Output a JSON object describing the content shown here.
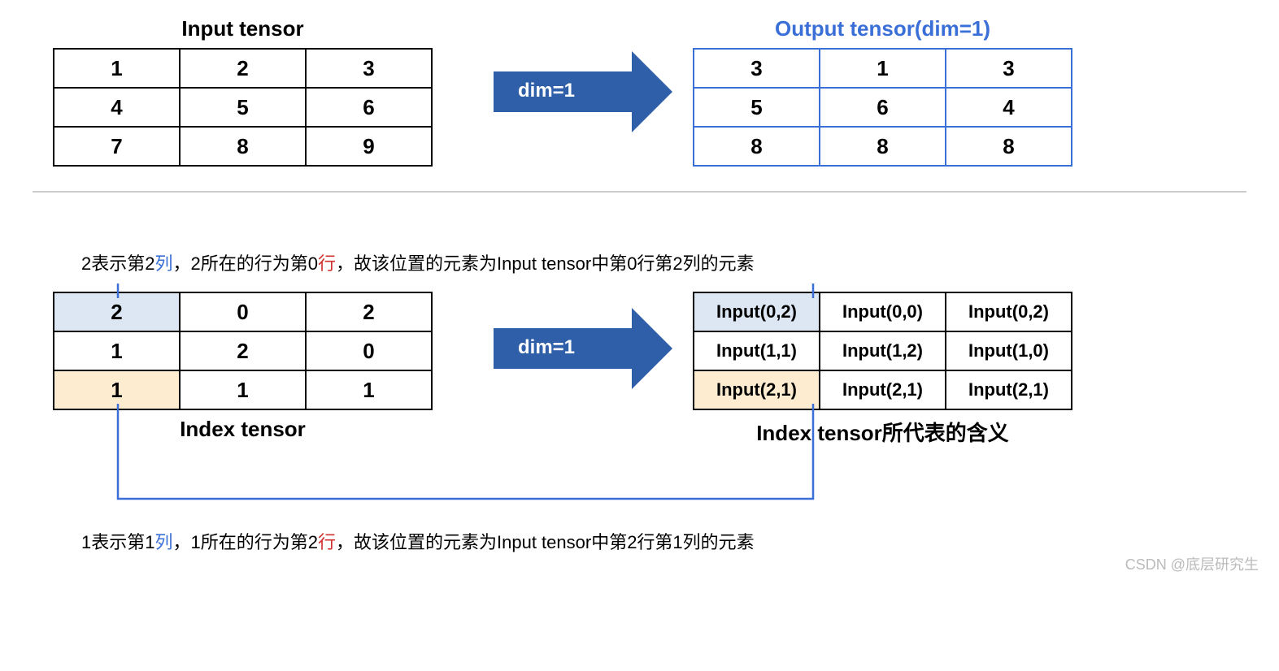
{
  "section1": {
    "input_title": "Input tensor",
    "output_title": "Output tensor(dim=1)",
    "arrow_label": "dim=1",
    "input": [
      [
        "1",
        "2",
        "3"
      ],
      [
        "4",
        "5",
        "6"
      ],
      [
        "7",
        "8",
        "9"
      ]
    ],
    "output": [
      [
        "3",
        "1",
        "3"
      ],
      [
        "5",
        "6",
        "4"
      ],
      [
        "8",
        "8",
        "8"
      ]
    ]
  },
  "section2": {
    "top_anno_pre": "2表示第2",
    "top_anno_col": "列",
    "top_anno_mid": "，2所在的行为第0",
    "top_anno_row": "行",
    "top_anno_post": "，故该位置的元素为Input tensor中第0行第2列的元素",
    "arrow_label": "dim=1",
    "index_title": "Index tensor",
    "meaning_title": "Index tensor所代表的含义",
    "index": [
      [
        "2",
        "0",
        "2"
      ],
      [
        "1",
        "2",
        "0"
      ],
      [
        "1",
        "1",
        "1"
      ]
    ],
    "meaning": [
      [
        "Input(0,2)",
        "Input(0,0)",
        "Input(0,2)"
      ],
      [
        "Input(1,1)",
        "Input(1,2)",
        "Input(1,0)"
      ],
      [
        "Input(2,1)",
        "Input(2,1)",
        "Input(2,1)"
      ]
    ],
    "bottom_anno_pre": "1表示第1",
    "bottom_anno_col": "列",
    "bottom_anno_mid": "，1所在的行为第2",
    "bottom_anno_row": "行",
    "bottom_anno_post": "，故该位置的元素为Input tensor中第2行第1列的元素"
  },
  "watermark": "CSDN @底层研究生"
}
